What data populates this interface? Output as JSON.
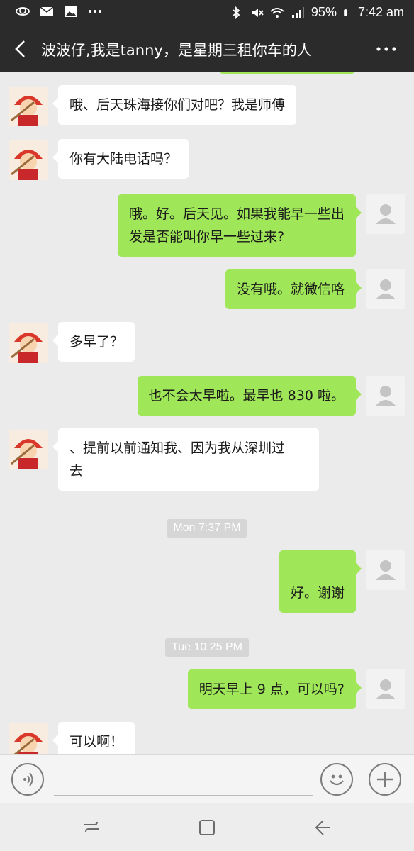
{
  "status_bar": {
    "battery": "95%",
    "time": "7:42 am",
    "left_icons": [
      "weather-icon",
      "mail-icon",
      "image-icon",
      "more-dots-icon"
    ],
    "right_icons": [
      "bluetooth-icon",
      "mute-icon",
      "wifi-icon",
      "signal-icon",
      "battery-icon"
    ]
  },
  "header": {
    "title": "波波仔,我是tanny，是星期三租你车的人"
  },
  "colors": {
    "header_bg": "#2b2b2b",
    "chat_bg": "#ebebeb",
    "outgoing_bubble": "#9fe658",
    "incoming_bubble": "#ffffff",
    "timestamp_bg": "#d6d6d6"
  },
  "messages": [
    {
      "side": "in",
      "text": "哦、后天珠海接你们对吧？我是师傅"
    },
    {
      "side": "in",
      "text": "你有大陆电话吗？"
    },
    {
      "side": "out",
      "lines": [
        "哦。好。后天见。如果我能早一些出",
        "发是否能叫你早一些过来?"
      ]
    },
    {
      "side": "out",
      "text": "没有哦。就微信咯"
    },
    {
      "side": "in",
      "text": "多早了？"
    },
    {
      "side": "out",
      "text": "也不会太早啦。最早也 830 啦。"
    },
    {
      "side": "in",
      "lines": [
        "、提前以前通知我、因为我从深圳过",
        "去"
      ]
    },
    {
      "side": "time",
      "text": "Mon 7:37 PM"
    },
    {
      "side": "out",
      "text": "好。谢谢"
    },
    {
      "side": "time",
      "text": "Tue 10:25 PM"
    },
    {
      "side": "out",
      "text": "明天早上 9 点，可以吗?"
    },
    {
      "side": "in",
      "text": "可以啊！"
    }
  ],
  "input": {
    "value": "",
    "placeholder": ""
  },
  "nav": {
    "icons": [
      "recent-apps-icon",
      "home-icon",
      "back-icon"
    ]
  }
}
